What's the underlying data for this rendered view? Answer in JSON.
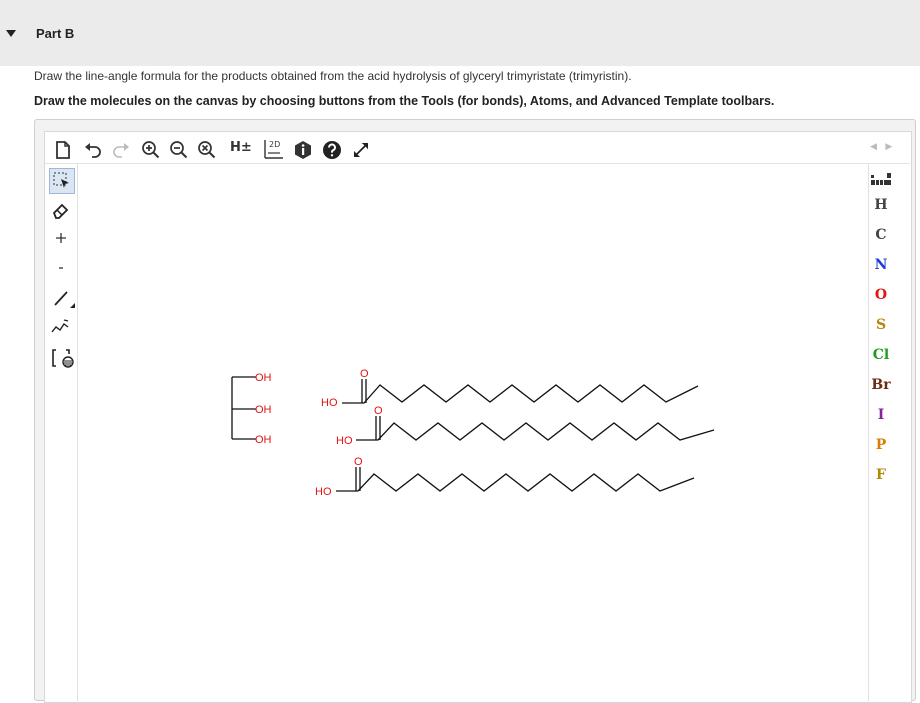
{
  "part": {
    "title": "Part B"
  },
  "instructions": {
    "line1": "Draw the line-angle formula for the products obtained from the acid hydrolysis of glyceryl trimyristate (trimyristin).",
    "line2": "Draw the molecules on the canvas by choosing buttons from the Tools (for bonds), Atoms, and Advanced Template toolbars."
  },
  "toolbar": {
    "h_toggle_label": "H±",
    "clean_label": "2D"
  },
  "atoms": {
    "items": [
      {
        "symbol": "H",
        "color": "#444444"
      },
      {
        "symbol": "C",
        "color": "#444444"
      },
      {
        "symbol": "N",
        "color": "#1f3bd6"
      },
      {
        "symbol": "O",
        "color": "#e01414"
      },
      {
        "symbol": "S",
        "color": "#b8860b"
      },
      {
        "symbol": "Cl",
        "color": "#1e9e1e"
      },
      {
        "symbol": "Br",
        "color": "#6b2a14"
      },
      {
        "symbol": "I",
        "color": "#8a1fa0"
      },
      {
        "symbol": "P",
        "color": "#d97e00"
      },
      {
        "symbol": "F",
        "color": "#b08a00"
      }
    ]
  },
  "canvas": {
    "glycerol_oh_labels": [
      "OH",
      "OH",
      "OH"
    ],
    "acid_ho_labels": [
      "HO",
      "HO",
      "HO"
    ],
    "carbonyl_o_labels": [
      "O",
      "O",
      "O"
    ],
    "colors": {
      "heteroatom": "#e01414",
      "bond": "#111111"
    }
  }
}
